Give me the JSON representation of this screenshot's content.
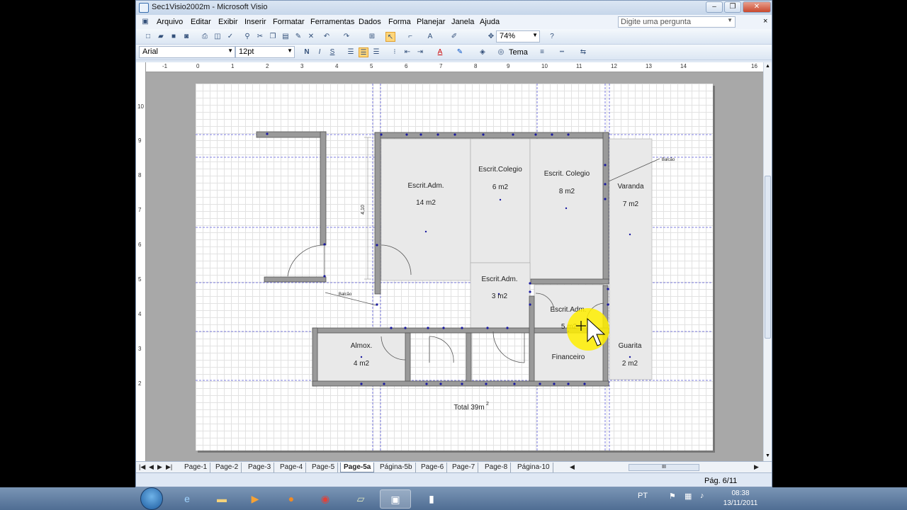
{
  "window": {
    "title": "Sec1Visio2002m - Microsoft Visio",
    "minimize": "–",
    "restore": "❐",
    "close": "✕"
  },
  "menu": {
    "items": [
      "Arquivo",
      "Editar",
      "Exibir",
      "Inserir",
      "Formatar",
      "Ferramentas",
      "Dados",
      "Forma",
      "Planejar",
      "Janela",
      "Ajuda"
    ],
    "ask_placeholder": "Digite uma pergunta",
    "mdi_close": "×"
  },
  "toolbar": {
    "zoom": "74%",
    "font": "Arial",
    "font_size": "12pt",
    "bold": "N",
    "italic": "I",
    "underline": "S",
    "theme": "Tema",
    "text_tool": "A"
  },
  "ruler": {
    "h": [
      "-1",
      "0",
      "1",
      "2",
      "3",
      "4",
      "5",
      "6",
      "7",
      "8",
      "9",
      "10",
      "11",
      "12",
      "13",
      "14",
      "15",
      "16"
    ],
    "v": [
      "10",
      "9",
      "8",
      "7",
      "6",
      "5",
      "4",
      "3",
      "2"
    ]
  },
  "floorplan": {
    "rooms": [
      {
        "name": "Escrit.Adm.",
        "area": "14 m2"
      },
      {
        "name": "Escrit.Colegio",
        "area": "6 m2"
      },
      {
        "name": "Escrit. Colegio",
        "area": "8 m2"
      },
      {
        "name": "Varanda",
        "area": "7 m2"
      },
      {
        "name": "Escrit.Adm.",
        "area": "3 m2"
      },
      {
        "name": "Escrit.Adm.",
        "area": "5 m2"
      },
      {
        "name": "Almox.",
        "area": "4 m2"
      },
      {
        "name": "Financeiro",
        "area": ""
      },
      {
        "name": "Guarita",
        "area": "2 m2"
      }
    ],
    "labels": {
      "balcao_1": "Balcão",
      "balcao_2": "Balcão",
      "dimension": "4,10",
      "total": "Total 39m",
      "total_sup": "2"
    },
    "colors": {
      "wall": "#9a9a9a",
      "wall_edge": "#555555",
      "guide": "#5a5ad8",
      "highlight": "#ffee00"
    }
  },
  "tabs": {
    "items": [
      "Page-1",
      "Page-2",
      "Page-3",
      "Page-4",
      "Page-5",
      "Page-5a",
      "Página-5b",
      "Page-6",
      "Page-7",
      "Page-8",
      "Página-10"
    ],
    "active": "Page-5a",
    "scroll_grip": "III"
  },
  "status": {
    "page": "Pág. 6/11"
  },
  "taskbar": {
    "lang": "PT",
    "time": "08:38",
    "date": "13/11/2011"
  }
}
